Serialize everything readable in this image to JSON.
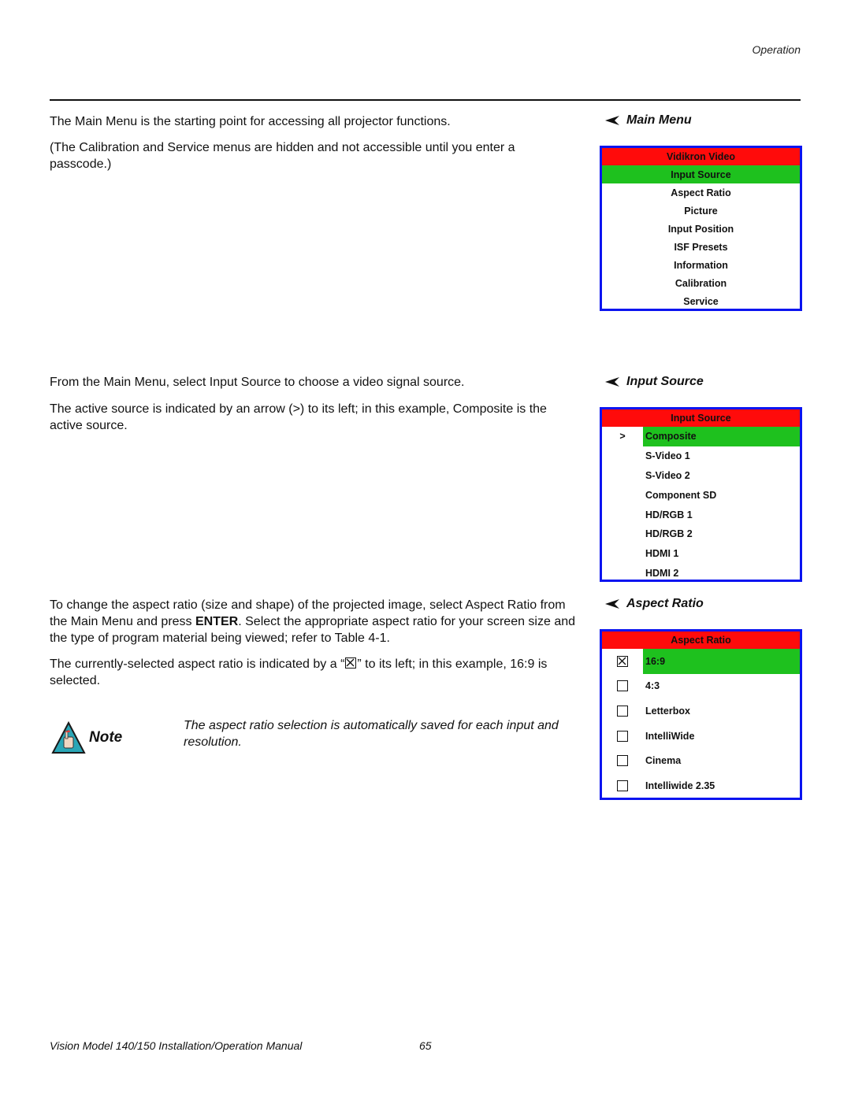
{
  "header": {
    "section": "Operation"
  },
  "sections": {
    "main_menu": {
      "paragraphs": [
        "The Main Menu is the starting point for accessing all projector functions.",
        "(The Calibration and Service menus are hidden and not accessible until you enter a passcode.)"
      ],
      "caption": "Main Menu",
      "menu": {
        "title": "Vidikron Video",
        "items": [
          "Input Source",
          "Aspect Ratio",
          "Picture",
          "Input Position",
          "ISF Presets",
          "Information",
          "Calibration",
          "Service"
        ],
        "highlighted": "Input Source"
      }
    },
    "input_source": {
      "paragraphs": [
        "From the Main Menu, select Input Source to choose a video signal source.",
        "The active source is indicated by an arrow (>) to its left; in this example, Composite is the active source."
      ],
      "caption": "Input Source",
      "menu": {
        "title": "Input Source",
        "active_marker": ">",
        "items": [
          "Composite",
          "S-Video 1",
          "S-Video 2",
          "Component SD",
          "HD/RGB 1",
          "HD/RGB 2",
          "HDMI 1",
          "HDMI 2"
        ],
        "active": "Composite"
      }
    },
    "aspect_ratio": {
      "paragraph1_pre": "To change the aspect ratio (size and shape) of the projected image, select Aspect Ratio from the Main Menu and press ",
      "paragraph1_bold": "ENTER",
      "paragraph1_post": ". Select the appropriate aspect ratio for your screen size and the type of program material being viewed; refer to Table 4-1.",
      "paragraph2_pre": "The currently-selected aspect ratio is indicated by a “",
      "paragraph2_post": "” to its left; in this example, 16:9 is selected.",
      "caption": "Aspect Ratio",
      "menu": {
        "title": "Aspect Ratio",
        "items": [
          "16:9",
          "4:3",
          "Letterbox",
          "IntelliWide",
          "Cinema",
          "Intelliwide 2.35"
        ],
        "selected": "16:9"
      }
    }
  },
  "note": {
    "label": "Note",
    "text": "The aspect ratio selection is automatically saved for each input and resolution."
  },
  "footer": {
    "manual_title": "Vision Model 140/150 Installation/Operation Manual",
    "page_number": "65"
  },
  "colors": {
    "menu_border": "#0a14f0",
    "menu_title_bg": "#ff0b0b",
    "menu_highlight_bg": "#1ec11e",
    "note_icon_bg": "#2aa6b6"
  }
}
